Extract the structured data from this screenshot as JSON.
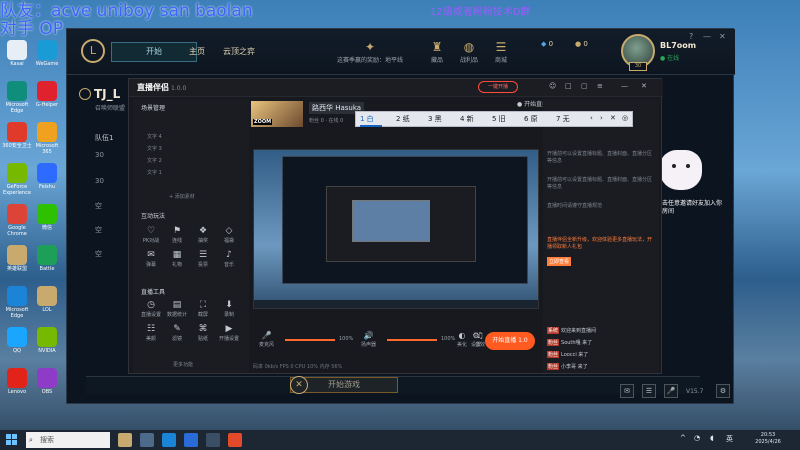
{
  "overlay": {
    "top_left_line1": "队友：acve uniboy san baolan",
    "top_left_line2": "对手 OP",
    "top_center": "12级或者粉粉技术D群"
  },
  "desktop": {
    "icons": [
      {
        "label": "Kasai",
        "color": "#e7eef5"
      },
      {
        "label": "WeGame",
        "color": "#1b9bd6"
      },
      {
        "label": "Microsoft Edge",
        "color": "#0f8e7b"
      },
      {
        "label": "G-Helper",
        "color": "#e0222e"
      },
      {
        "label": "360安全卫士",
        "color": "#e03a2a"
      },
      {
        "label": "Microsoft 365",
        "color": "#f0a11f"
      },
      {
        "label": "GeForce Experience",
        "color": "#76b900"
      },
      {
        "label": "Feishu",
        "color": "#2d6bff"
      },
      {
        "label": "Google Chrome",
        "color": "#db4437"
      },
      {
        "label": "微信",
        "color": "#2ec100"
      },
      {
        "label": "英雄联盟",
        "color": "#c8aa6e"
      },
      {
        "label": "Battle",
        "color": "#1d9f57"
      },
      {
        "label": "Microsoft Edge",
        "color": "#1b84d6"
      },
      {
        "label": "LOL",
        "color": "#c8aa6e"
      },
      {
        "label": "QQ",
        "color": "#1aa5ff"
      },
      {
        "label": "NVIDIA",
        "color": "#76b900"
      },
      {
        "label": "Lenovo",
        "color": "#e2231a"
      },
      {
        "label": "OBS",
        "color": "#8e3cc7"
      }
    ]
  },
  "lol": {
    "logo": "L",
    "play_label": "开始",
    "nav": [
      "主页",
      "云顶之弈"
    ],
    "top_icons": [
      {
        "glyph": "✦",
        "label": "这赛季赢的奖励：地平线"
      },
      {
        "glyph": "♜",
        "label": "藏品"
      },
      {
        "glyph": "◍",
        "label": "战利品"
      },
      {
        "glyph": "☰",
        "label": "商城"
      }
    ],
    "currency": {
      "blue": "0",
      "gold": "0"
    },
    "user": {
      "name": "BL7oom",
      "status": "在线",
      "level": "30"
    },
    "window_controls": [
      "?",
      "—",
      "✕"
    ],
    "lobby_title": "TJ_L",
    "lobby_sub": "召唤师联盟",
    "team_label": "队伍1",
    "team_rows": [
      "30",
      "30",
      "空",
      "空",
      "空"
    ],
    "right_side_text": "点击任意邀请好友加入你的房间",
    "start_label": "开始游戏",
    "start_x": "✕",
    "bottom_right_icons": [
      "✉",
      "☰",
      "🎤",
      "⚙"
    ],
    "version": "V15.7"
  },
  "stream": {
    "app_title": "直播伴侣",
    "app_version": "1.0.0",
    "remind_label": "一键开播",
    "top_controls": [
      "☺",
      "□",
      "▢",
      "≡",
      "—",
      "✕"
    ],
    "scene_header": "场景管理",
    "scenes": [
      "文字 4",
      "文字 3",
      "文字 2",
      "文字 1"
    ],
    "add_source": "+ 添加素材",
    "tools_header_1": "互动玩法",
    "tools_row1": [
      {
        "glyph": "♡",
        "label": "PK对战"
      },
      {
        "glyph": "⚑",
        "label": "连线"
      },
      {
        "glyph": "❖",
        "label": "抽奖"
      },
      {
        "glyph": "◇",
        "label": "福袋"
      }
    ],
    "tools_row2": [
      {
        "glyph": "✉",
        "label": "弹幕"
      },
      {
        "glyph": "▦",
        "label": "礼物"
      },
      {
        "glyph": "☰",
        "label": "投票"
      },
      {
        "glyph": "♪",
        "label": "音乐"
      }
    ],
    "tools_header_2": "直播工具",
    "tools_row3": [
      {
        "glyph": "◷",
        "label": "直播设置"
      },
      {
        "glyph": "▤",
        "label": "数据统计"
      },
      {
        "glyph": "⛶",
        "label": "截屏"
      },
      {
        "glyph": "⬇",
        "label": "录制"
      }
    ],
    "tools_row4": [
      {
        "glyph": "☷",
        "label": "美颜"
      },
      {
        "glyph": "✎",
        "label": "滤镜"
      },
      {
        "glyph": "⌘",
        "label": "贴纸"
      },
      {
        "glyph": "▶",
        "label": "开播设置"
      }
    ],
    "more_tools": "更多功能",
    "streamer_name": "路西华 Hasuka",
    "streamer_stats": "粉丝 0 · 在线 0",
    "thumb_text": "ZOOM",
    "live_status_text": "开始直播",
    "controls": [
      {
        "glyph": "🎤",
        "label": "麦克风",
        "value": "100%"
      },
      {
        "glyph": "🔊",
        "label": "扬声器",
        "value": "100%"
      }
    ],
    "extra_controls": [
      {
        "glyph": "◐",
        "label": "美化"
      },
      {
        "glyph": "♫",
        "label": "音效"
      },
      {
        "glyph": "⚙",
        "label": "设置"
      }
    ],
    "live_button": "开始直播 1.0",
    "status_line": "码率 0kb/s  FPS 0  CPU 10%  内存 56%",
    "right_paras": [
      "开播前可以设置直播标题、直播封面、直播分区等信息",
      "开播前可以设置直播标题、直播封面、直播分区等信息",
      "直播时间请遵守直播规范"
    ],
    "promo": "直播伴侣全新升级，欢迎体验更多直播玩法，开播领取新人礼包",
    "promo_badge": "立即查看",
    "chat": [
      {
        "tag": "系统",
        "text": "欢迎来到直播间"
      },
      {
        "tag": "粉丝",
        "text": "South嘎 来了"
      },
      {
        "tag": "粉丝",
        "text": "Loocci 来了"
      },
      {
        "tag": "粉丝",
        "text": "小李哥 来了"
      }
    ]
  },
  "menu": {
    "items": [
      "1 白",
      "2 纸",
      "3 黑",
      "4 新",
      "5 旧",
      "6 原",
      "7 无"
    ],
    "active_index": 0,
    "controls": [
      "‹",
      "›",
      "✕",
      "◎"
    ]
  },
  "taskbar": {
    "search_placeholder": "搜索",
    "tray_up": "^",
    "wifi": "◔",
    "volume": "◖",
    "lang": "英",
    "time": "20:53",
    "date": "2025/4/26"
  }
}
